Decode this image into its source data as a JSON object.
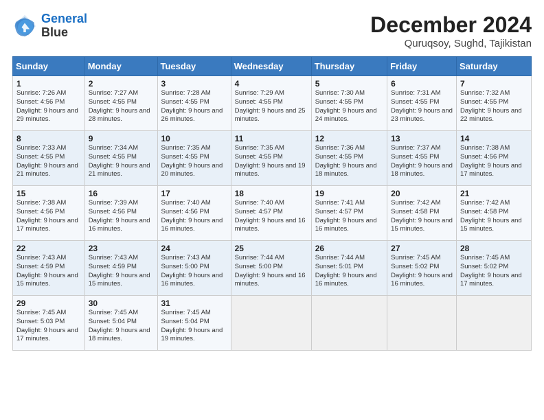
{
  "header": {
    "logo_line1": "General",
    "logo_line2": "Blue",
    "main_title": "December 2024",
    "subtitle": "Quruqsoy, Sughd, Tajikistan"
  },
  "days_of_week": [
    "Sunday",
    "Monday",
    "Tuesday",
    "Wednesday",
    "Thursday",
    "Friday",
    "Saturday"
  ],
  "weeks": [
    [
      {
        "day": "1",
        "sunrise": "Sunrise: 7:26 AM",
        "sunset": "Sunset: 4:56 PM",
        "daylight": "Daylight: 9 hours and 29 minutes."
      },
      {
        "day": "2",
        "sunrise": "Sunrise: 7:27 AM",
        "sunset": "Sunset: 4:55 PM",
        "daylight": "Daylight: 9 hours and 28 minutes."
      },
      {
        "day": "3",
        "sunrise": "Sunrise: 7:28 AM",
        "sunset": "Sunset: 4:55 PM",
        "daylight": "Daylight: 9 hours and 26 minutes."
      },
      {
        "day": "4",
        "sunrise": "Sunrise: 7:29 AM",
        "sunset": "Sunset: 4:55 PM",
        "daylight": "Daylight: 9 hours and 25 minutes."
      },
      {
        "day": "5",
        "sunrise": "Sunrise: 7:30 AM",
        "sunset": "Sunset: 4:55 PM",
        "daylight": "Daylight: 9 hours and 24 minutes."
      },
      {
        "day": "6",
        "sunrise": "Sunrise: 7:31 AM",
        "sunset": "Sunset: 4:55 PM",
        "daylight": "Daylight: 9 hours and 23 minutes."
      },
      {
        "day": "7",
        "sunrise": "Sunrise: 7:32 AM",
        "sunset": "Sunset: 4:55 PM",
        "daylight": "Daylight: 9 hours and 22 minutes."
      }
    ],
    [
      {
        "day": "8",
        "sunrise": "Sunrise: 7:33 AM",
        "sunset": "Sunset: 4:55 PM",
        "daylight": "Daylight: 9 hours and 21 minutes."
      },
      {
        "day": "9",
        "sunrise": "Sunrise: 7:34 AM",
        "sunset": "Sunset: 4:55 PM",
        "daylight": "Daylight: 9 hours and 21 minutes."
      },
      {
        "day": "10",
        "sunrise": "Sunrise: 7:35 AM",
        "sunset": "Sunset: 4:55 PM",
        "daylight": "Daylight: 9 hours and 20 minutes."
      },
      {
        "day": "11",
        "sunrise": "Sunrise: 7:35 AM",
        "sunset": "Sunset: 4:55 PM",
        "daylight": "Daylight: 9 hours and 19 minutes."
      },
      {
        "day": "12",
        "sunrise": "Sunrise: 7:36 AM",
        "sunset": "Sunset: 4:55 PM",
        "daylight": "Daylight: 9 hours and 18 minutes."
      },
      {
        "day": "13",
        "sunrise": "Sunrise: 7:37 AM",
        "sunset": "Sunset: 4:55 PM",
        "daylight": "Daylight: 9 hours and 18 minutes."
      },
      {
        "day": "14",
        "sunrise": "Sunrise: 7:38 AM",
        "sunset": "Sunset: 4:56 PM",
        "daylight": "Daylight: 9 hours and 17 minutes."
      }
    ],
    [
      {
        "day": "15",
        "sunrise": "Sunrise: 7:38 AM",
        "sunset": "Sunset: 4:56 PM",
        "daylight": "Daylight: 9 hours and 17 minutes."
      },
      {
        "day": "16",
        "sunrise": "Sunrise: 7:39 AM",
        "sunset": "Sunset: 4:56 PM",
        "daylight": "Daylight: 9 hours and 16 minutes."
      },
      {
        "day": "17",
        "sunrise": "Sunrise: 7:40 AM",
        "sunset": "Sunset: 4:56 PM",
        "daylight": "Daylight: 9 hours and 16 minutes."
      },
      {
        "day": "18",
        "sunrise": "Sunrise: 7:40 AM",
        "sunset": "Sunset: 4:57 PM",
        "daylight": "Daylight: 9 hours and 16 minutes."
      },
      {
        "day": "19",
        "sunrise": "Sunrise: 7:41 AM",
        "sunset": "Sunset: 4:57 PM",
        "daylight": "Daylight: 9 hours and 16 minutes."
      },
      {
        "day": "20",
        "sunrise": "Sunrise: 7:42 AM",
        "sunset": "Sunset: 4:58 PM",
        "daylight": "Daylight: 9 hours and 15 minutes."
      },
      {
        "day": "21",
        "sunrise": "Sunrise: 7:42 AM",
        "sunset": "Sunset: 4:58 PM",
        "daylight": "Daylight: 9 hours and 15 minutes."
      }
    ],
    [
      {
        "day": "22",
        "sunrise": "Sunrise: 7:43 AM",
        "sunset": "Sunset: 4:59 PM",
        "daylight": "Daylight: 9 hours and 15 minutes."
      },
      {
        "day": "23",
        "sunrise": "Sunrise: 7:43 AM",
        "sunset": "Sunset: 4:59 PM",
        "daylight": "Daylight: 9 hours and 15 minutes."
      },
      {
        "day": "24",
        "sunrise": "Sunrise: 7:43 AM",
        "sunset": "Sunset: 5:00 PM",
        "daylight": "Daylight: 9 hours and 16 minutes."
      },
      {
        "day": "25",
        "sunrise": "Sunrise: 7:44 AM",
        "sunset": "Sunset: 5:00 PM",
        "daylight": "Daylight: 9 hours and 16 minutes."
      },
      {
        "day": "26",
        "sunrise": "Sunrise: 7:44 AM",
        "sunset": "Sunset: 5:01 PM",
        "daylight": "Daylight: 9 hours and 16 minutes."
      },
      {
        "day": "27",
        "sunrise": "Sunrise: 7:45 AM",
        "sunset": "Sunset: 5:02 PM",
        "daylight": "Daylight: 9 hours and 16 minutes."
      },
      {
        "day": "28",
        "sunrise": "Sunrise: 7:45 AM",
        "sunset": "Sunset: 5:02 PM",
        "daylight": "Daylight: 9 hours and 17 minutes."
      }
    ],
    [
      {
        "day": "29",
        "sunrise": "Sunrise: 7:45 AM",
        "sunset": "Sunset: 5:03 PM",
        "daylight": "Daylight: 9 hours and 17 minutes."
      },
      {
        "day": "30",
        "sunrise": "Sunrise: 7:45 AM",
        "sunset": "Sunset: 5:04 PM",
        "daylight": "Daylight: 9 hours and 18 minutes."
      },
      {
        "day": "31",
        "sunrise": "Sunrise: 7:45 AM",
        "sunset": "Sunset: 5:04 PM",
        "daylight": "Daylight: 9 hours and 19 minutes."
      },
      null,
      null,
      null,
      null
    ]
  ]
}
